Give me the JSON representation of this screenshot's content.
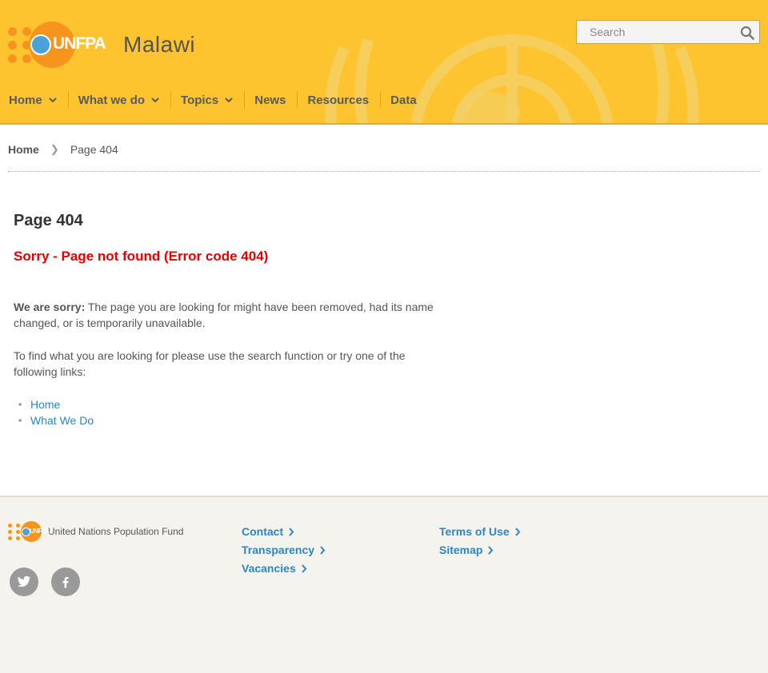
{
  "header": {
    "logo_text": "UNFPA",
    "country": "Malawi",
    "search": {
      "placeholder": "Search"
    },
    "nav": [
      {
        "label": "Home",
        "has_dropdown": true
      },
      {
        "label": "What we do",
        "has_dropdown": true
      },
      {
        "label": "Topics",
        "has_dropdown": true
      },
      {
        "label": "News",
        "has_dropdown": false
      },
      {
        "label": "Resources",
        "has_dropdown": false
      },
      {
        "label": "Data",
        "has_dropdown": false
      }
    ]
  },
  "breadcrumb": {
    "home": "Home",
    "current": "Page 404"
  },
  "main": {
    "page_title": "Page 404",
    "error_title": "Sorry - Page not found (Error code 404)",
    "sorry_label": "We are sorry:",
    "sorry_text": " The page you are looking for might have been removed, had its name changed, or is temporarily unavailable.",
    "find_text": "To find what you are looking for please use the search function or try one of the following links:",
    "links": [
      "Home",
      "What We Do"
    ]
  },
  "footer": {
    "logo_text": "UNFPA",
    "org_name": "United Nations Population Fund",
    "col1": [
      "Contact",
      "Transparency",
      "Vacancies"
    ],
    "col2": [
      "Terms of Use",
      "Sitemap"
    ],
    "social": [
      "twitter-icon",
      "facebook-icon"
    ]
  },
  "colors": {
    "header_bg": "#fdc42f",
    "brand_orange": "#f7941d",
    "error_red": "#e60000",
    "link_blue": "#2a87c0",
    "footer_bg": "#f5f3ee"
  }
}
